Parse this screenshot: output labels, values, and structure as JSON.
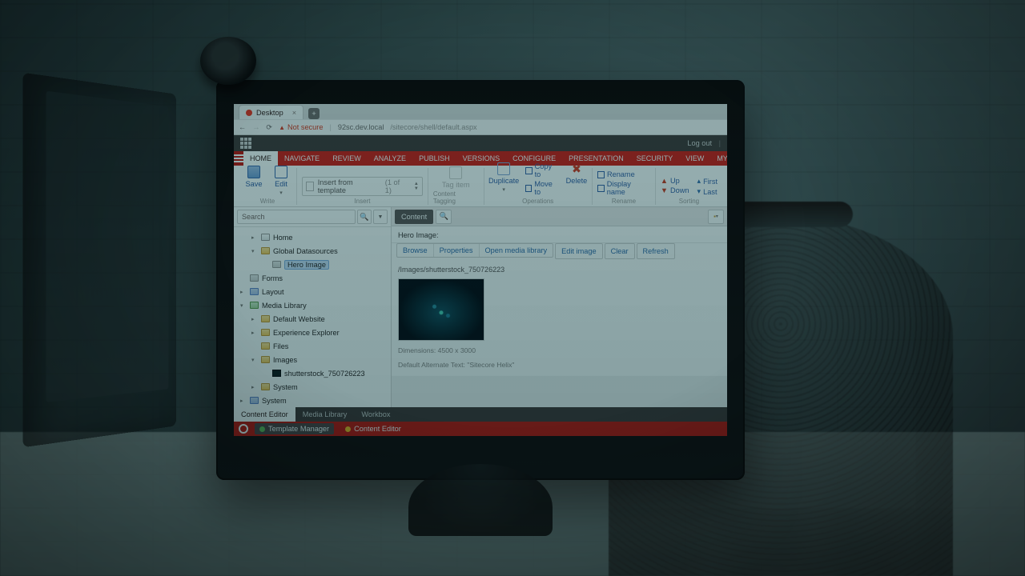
{
  "browser": {
    "tab_title": "Desktop",
    "security_text": "Not secure",
    "host": "92sc.dev.local",
    "path": "/sitecore/shell/default.aspx"
  },
  "header": {
    "logout": "Log out"
  },
  "ribbon": {
    "tabs": [
      "HOME",
      "NAVIGATE",
      "REVIEW",
      "ANALYZE",
      "PUBLISH",
      "VERSIONS",
      "CONFIGURE",
      "PRESENTATION",
      "SECURITY",
      "VIEW",
      "MY TOOLBAR"
    ],
    "active_tab": "HOME",
    "groups": {
      "write": {
        "label": "Write",
        "save": "Save",
        "edit": "Edit"
      },
      "insert": {
        "label": "Insert",
        "template": "Insert from template",
        "page_of": "(1 of 1)"
      },
      "tagging": {
        "label": "Content Tagging",
        "tag": "Tag item"
      },
      "operations": {
        "label": "Operations",
        "duplicate": "Duplicate",
        "copy_to": "Copy to",
        "move_to": "Move to",
        "delete": "Delete"
      },
      "rename": {
        "label": "Rename",
        "rename": "Rename",
        "display_name": "Display name"
      },
      "sorting": {
        "label": "Sorting",
        "up": "Up",
        "down": "Down",
        "first": "First",
        "last": "Last"
      }
    }
  },
  "sidebar": {
    "search_placeholder": "Search",
    "items": [
      {
        "label": "Home",
        "icon": "home",
        "expander": "▸",
        "indent": 1
      },
      {
        "label": "Global Datasources",
        "icon": "fld",
        "expander": "▾",
        "indent": 1
      },
      {
        "label": "Hero Image",
        "icon": "img",
        "expander": "",
        "indent": 2,
        "selected": true
      },
      {
        "label": "Forms",
        "icon": "form",
        "expander": "",
        "indent": 0
      },
      {
        "label": "Layout",
        "icon": "blue",
        "expander": "▸",
        "indent": 0
      },
      {
        "label": "Media Library",
        "icon": "green",
        "expander": "▾",
        "indent": 0
      },
      {
        "label": "Default Website",
        "icon": "fld",
        "expander": "▸",
        "indent": 1
      },
      {
        "label": "Experience Explorer",
        "icon": "fld",
        "expander": "▸",
        "indent": 1
      },
      {
        "label": "Files",
        "icon": "fld",
        "expander": "",
        "indent": 1
      },
      {
        "label": "Images",
        "icon": "fld",
        "expander": "▾",
        "indent": 1
      },
      {
        "label": "shutterstock_750726223",
        "icon": "img-dark",
        "expander": "",
        "indent": 2
      },
      {
        "label": "System",
        "icon": "fld",
        "expander": "▸",
        "indent": 1
      },
      {
        "label": "System",
        "icon": "blue",
        "expander": "▸",
        "indent": 0
      }
    ]
  },
  "content": {
    "tab_label": "Content",
    "section_title": "Hero Image:",
    "actions": [
      "Browse",
      "Properties",
      "Open media library",
      "Edit image",
      "Clear",
      "Refresh"
    ],
    "image_path": "/Images/shutterstock_750726223",
    "dimensions": "Dimensions: 4500 x 3000",
    "alt_text": "Default Alternate Text: \"Sitecore Helix\""
  },
  "bottom_tabs": [
    "Content Editor",
    "Media Library",
    "Workbox"
  ],
  "taskbar": {
    "template_manager": "Template Manager",
    "content_editor": "Content Editor"
  }
}
